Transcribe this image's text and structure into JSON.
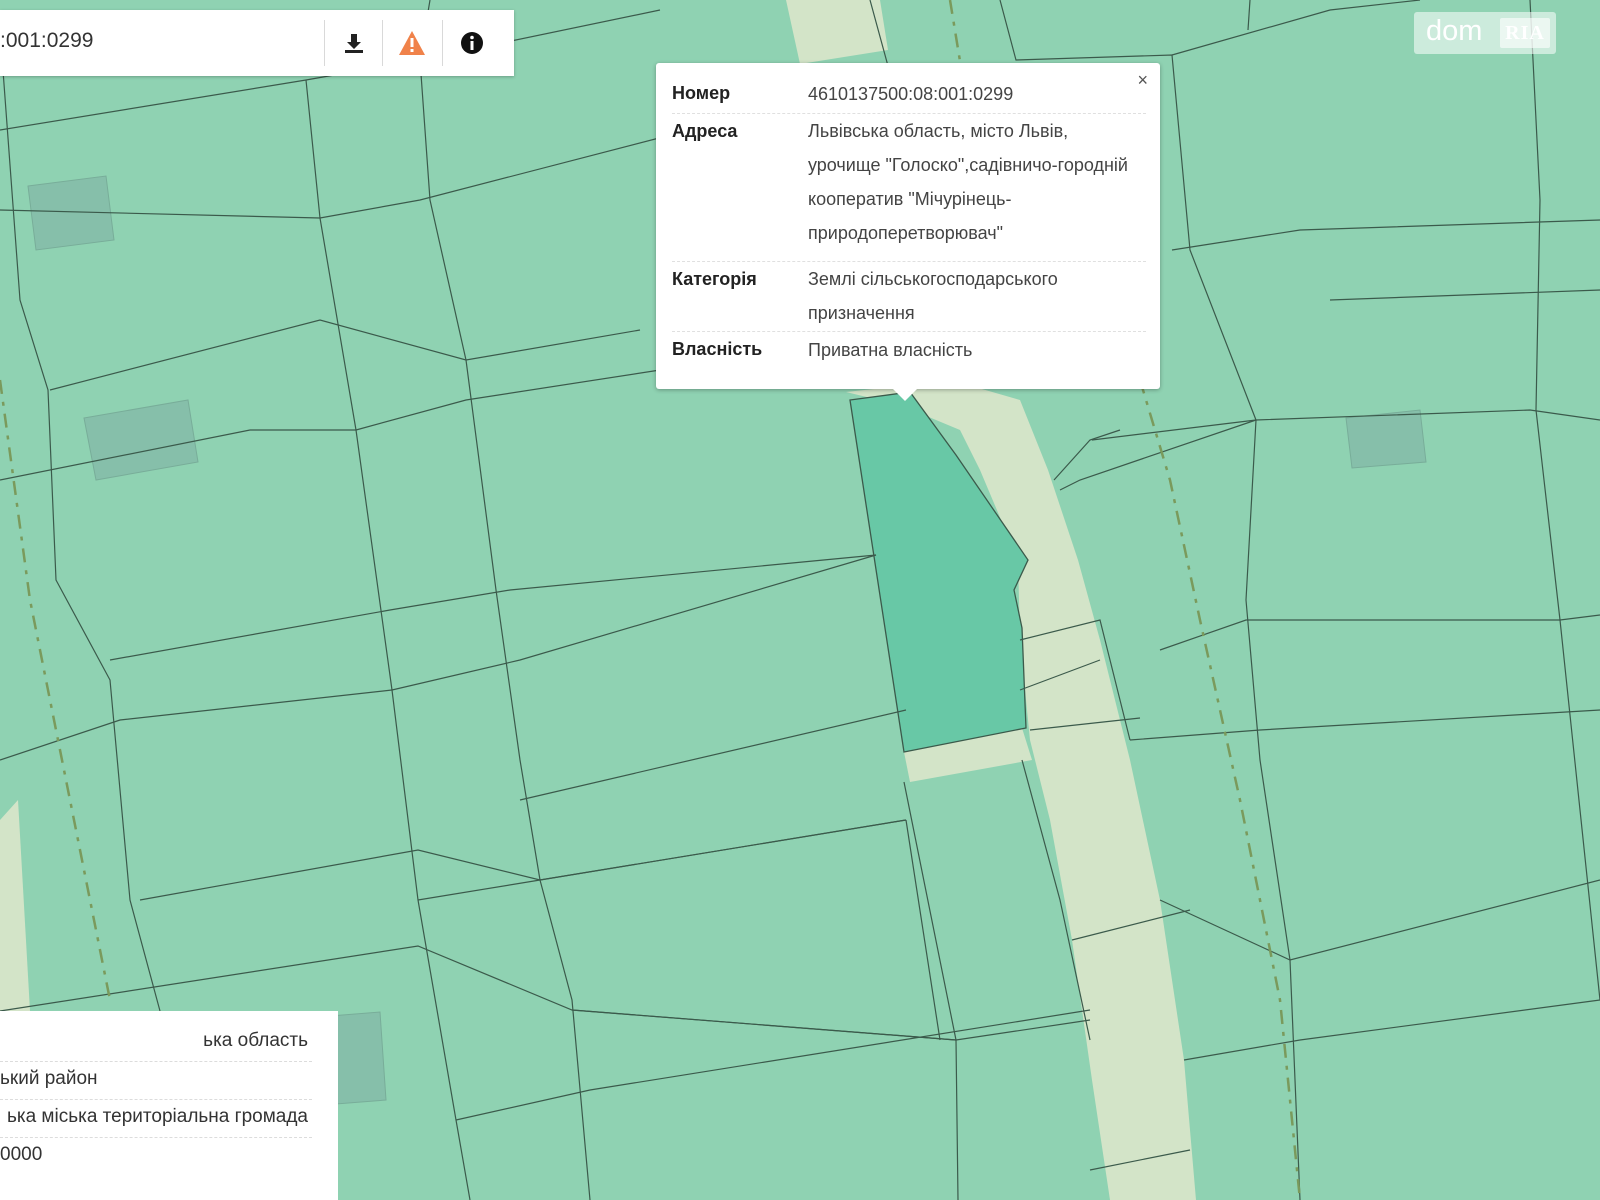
{
  "search": {
    "query": ":001:0299"
  },
  "toolbar": {
    "download_icon": "download-icon",
    "warning_icon": "warning-icon",
    "info_icon": "info-icon",
    "warning_color": "#f0824a"
  },
  "watermark": {
    "dom": "dom",
    "ria": "RIA"
  },
  "popup": {
    "close": "×",
    "rows": [
      {
        "key": "Номер",
        "value": "4610137500:08:001:0299"
      },
      {
        "key": "Адреса",
        "value": "Львівська область, місто Львів, урочище \"Голоско\",садівничо-городній кооператив \"Мічурінець-природоперетворювач\""
      },
      {
        "key": "Категорія",
        "value": "Землі сільськогосподарського призначення"
      },
      {
        "key": "Власність",
        "value": "Приватна власність"
      }
    ]
  },
  "info_panel": {
    "rows": [
      "ька область",
      "ький район",
      "ька міська територіальна громада",
      "0000"
    ]
  },
  "colors": {
    "parcel_fill": "#8fd2b2",
    "selected_parcel": "#68c8a6",
    "road": "#d3e4c8",
    "parcel_border": "#3b5a4b"
  }
}
